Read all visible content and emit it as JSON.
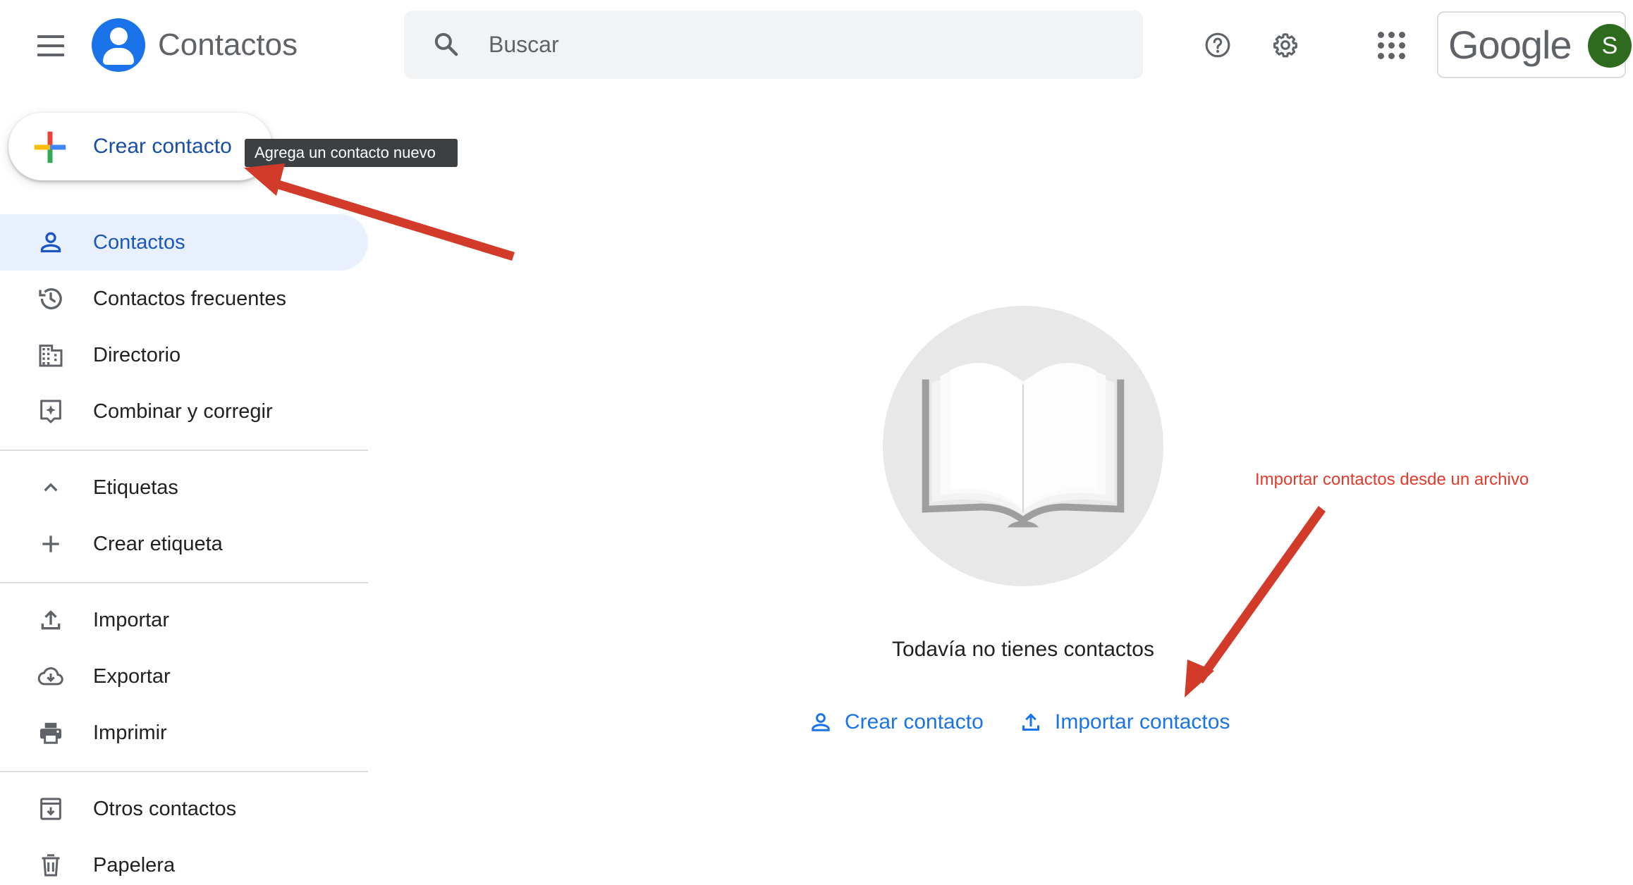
{
  "header": {
    "app_title": "Contactos",
    "search_placeholder": "Buscar",
    "brand": "Google",
    "avatar_initial": "S",
    "icons": [
      "menu-icon",
      "contacts-logo-icon",
      "search-icon",
      "help-icon",
      "settings-icon",
      "apps-grid-icon"
    ]
  },
  "create_button": {
    "label": "Crear contacto",
    "tooltip": "Agrega un contacto nuevo"
  },
  "sidebar": {
    "items": [
      {
        "label": "Contactos",
        "icon": "person-icon",
        "active": true
      },
      {
        "label": "Contactos frecuentes",
        "icon": "history-icon"
      },
      {
        "label": "Directorio",
        "icon": "building-icon"
      },
      {
        "label": "Combinar y corregir",
        "icon": "merge-sparkle-icon"
      },
      {
        "label": "Etiquetas",
        "icon": "chevron-up-icon"
      },
      {
        "label": "Crear etiqueta",
        "icon": "plus-icon"
      },
      {
        "label": "Importar",
        "icon": "upload-icon"
      },
      {
        "label": "Exportar",
        "icon": "cloud-download-icon"
      },
      {
        "label": "Imprimir",
        "icon": "printer-icon"
      },
      {
        "label": "Otros contactos",
        "icon": "archive-icon"
      },
      {
        "label": "Papelera",
        "icon": "trash-icon"
      }
    ]
  },
  "empty_state": {
    "title": "Todavía no tienes contactos",
    "create_label": "Crear contacto",
    "import_label": "Importar contactos"
  },
  "annotation": {
    "text": "Importar contactos desde un archivo",
    "color": "#e53a2a"
  },
  "colors": {
    "accent": "#1a73e8",
    "active_bg": "#e8f0fe",
    "avatar_bg": "#2e6b1f"
  }
}
